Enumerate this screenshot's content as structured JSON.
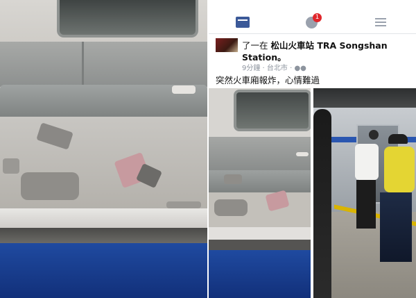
{
  "header": {
    "notification_count": "1",
    "icons": [
      "news-feed-icon",
      "globe-icon",
      "menu-icon"
    ]
  },
  "post": {
    "author_suffix": "了一在",
    "location": "松山火車站 TRA Songshan",
    "location_cont": "Station。",
    "meta": "9分鐘 · 台北市 · ",
    "text": "突然火車廂報炸，心情難過"
  },
  "colors": {
    "facebook_blue": "#3b5998",
    "badge_red": "#e0262b",
    "train_blue": "#1f4aa0"
  }
}
